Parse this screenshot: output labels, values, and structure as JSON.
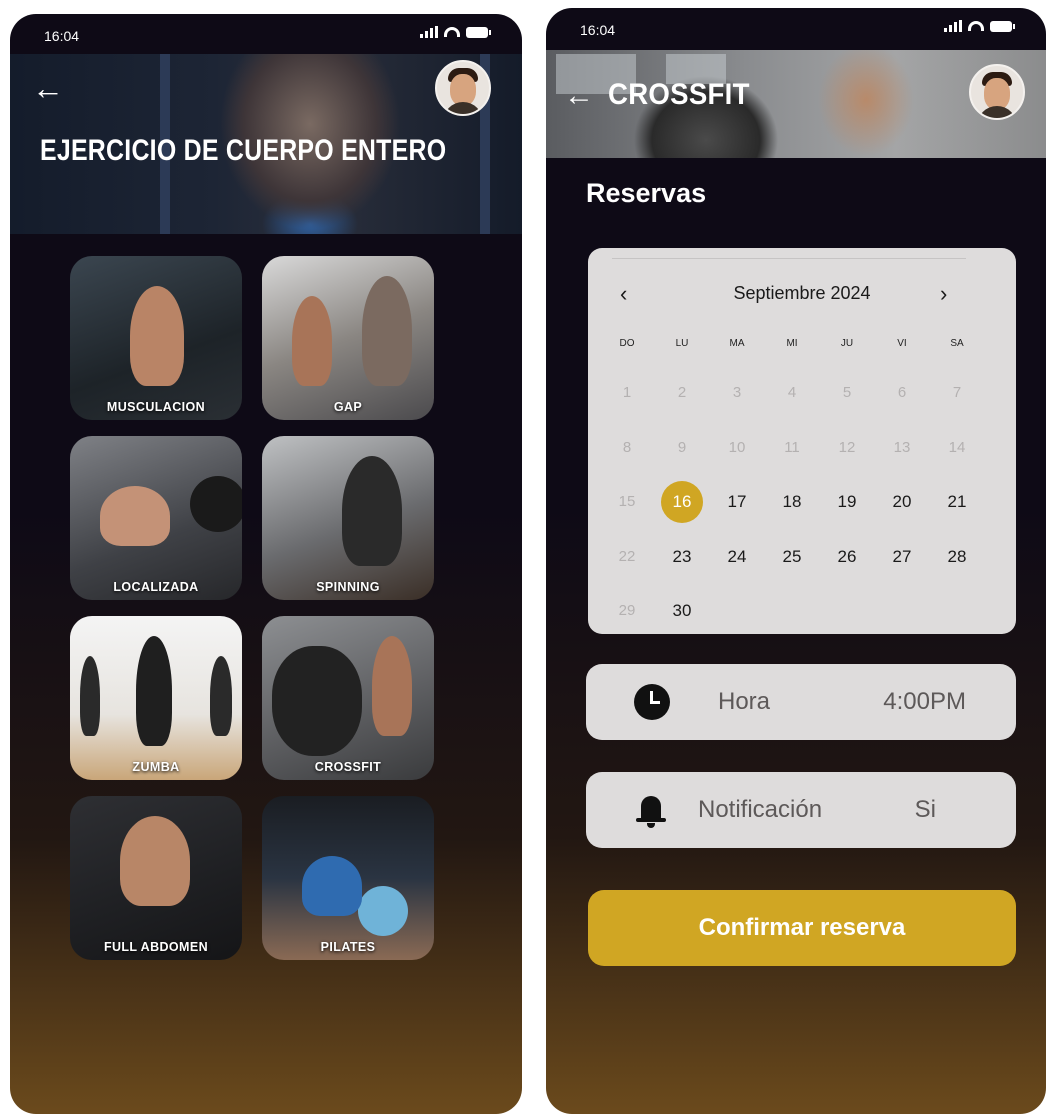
{
  "left_screen": {
    "status": {
      "time": "16:04"
    },
    "title": "EJERCICIO DE CUERPO ENTERO",
    "classes": [
      {
        "label": "MUSCULACION"
      },
      {
        "label": "GAP"
      },
      {
        "label": "LOCALIZADA"
      },
      {
        "label": "SPINNING"
      },
      {
        "label": "ZUMBA"
      },
      {
        "label": "CROSSFIT"
      },
      {
        "label": "FULL ABDOMEN"
      },
      {
        "label": "PILATES"
      }
    ]
  },
  "right_screen": {
    "status": {
      "time": "16:04"
    },
    "header_title": "CROSSFIT",
    "section_title": "Reservas",
    "calendar": {
      "month": "Septiembre 2024",
      "prev": "‹",
      "next": "›",
      "weekdays": [
        "DO",
        "LU",
        "MA",
        "MI",
        "JU",
        "VI",
        "SA"
      ],
      "days": [
        "1",
        "2",
        "3",
        "4",
        "5",
        "6",
        "7",
        "8",
        "9",
        "10",
        "11",
        "12",
        "13",
        "14",
        "15",
        "16",
        "17",
        "18",
        "19",
        "20",
        "21",
        "22",
        "23",
        "24",
        "25",
        "26",
        "27",
        "28",
        "29",
        "30"
      ],
      "selected_day": "16"
    },
    "time_field": {
      "label": "Hora",
      "value": "4:00PM"
    },
    "notification_field": {
      "label": "Notificación",
      "value": "Si"
    },
    "confirm_label": "Confirmar reserva"
  },
  "colors": {
    "accent": "#d0a623",
    "background": "#0e0a16",
    "field_bg": "#dedcdc"
  },
  "icons": [
    "back-arrow-icon",
    "clock-icon",
    "bell-icon",
    "signal-icon",
    "wifi-icon",
    "battery-icon"
  ]
}
